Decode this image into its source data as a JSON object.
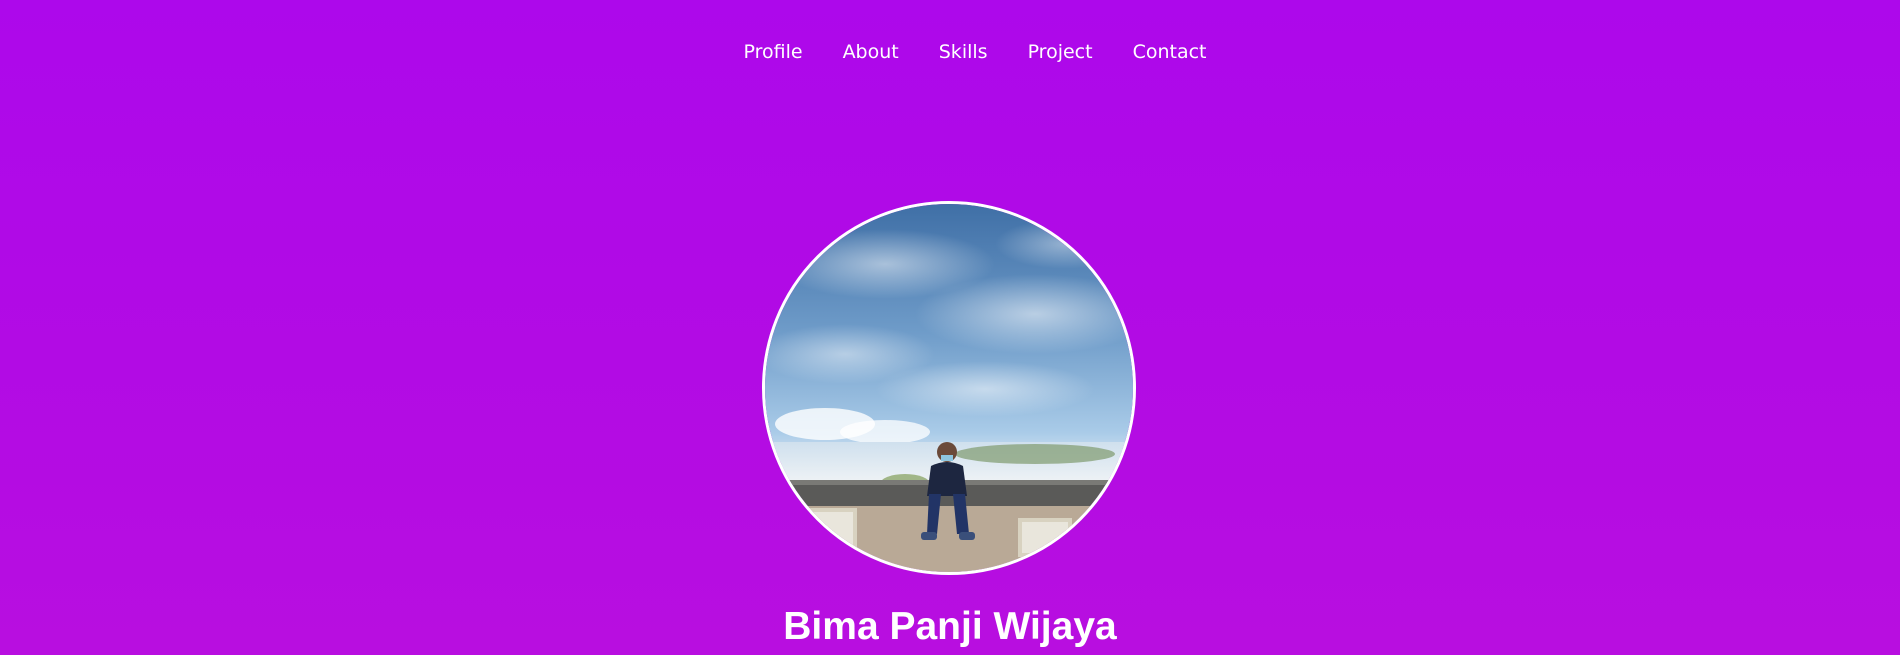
{
  "nav": {
    "items": [
      {
        "label": "Profile"
      },
      {
        "label": "About"
      },
      {
        "label": "Skills"
      },
      {
        "label": "Project"
      },
      {
        "label": "Contact"
      }
    ]
  },
  "profile": {
    "name": "Bima Panji Wijaya",
    "photo_icon": "profile-photo"
  },
  "colors": {
    "background_top": "#ad08eb",
    "background_bottom": "#b80ee0",
    "text": "#ffffff",
    "avatar_border": "#ffffff"
  }
}
